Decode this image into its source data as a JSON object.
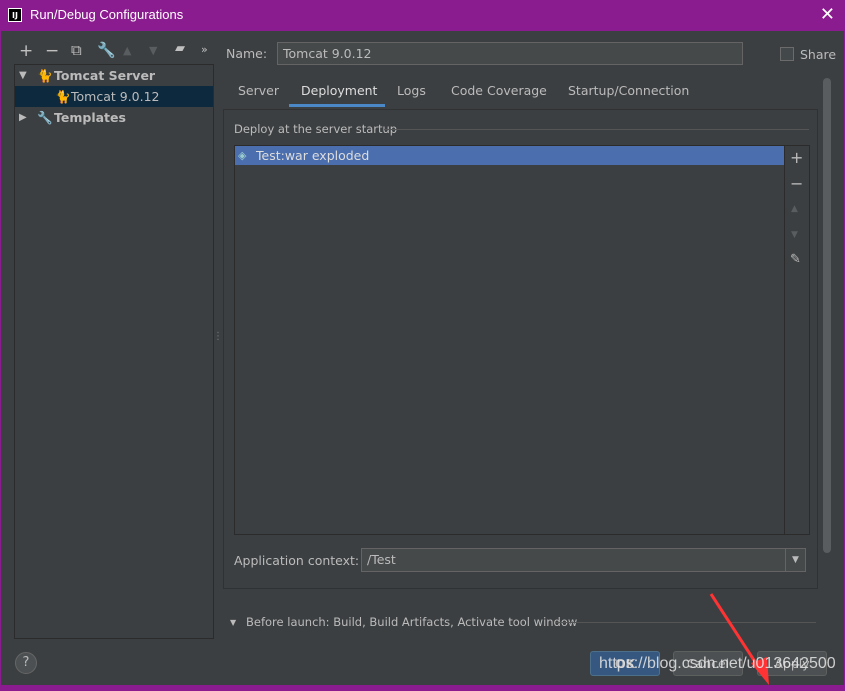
{
  "window": {
    "title": "Run/Debug Configurations",
    "app_icon": "IJ"
  },
  "toolbar": {
    "icons": [
      "plus-icon",
      "minus-icon",
      "copy-icon",
      "wrench-icon",
      "arrow-up-icon",
      "arrow-down-icon",
      "folder-add-icon",
      "more-icon"
    ]
  },
  "tree": {
    "items": [
      {
        "label": "Tomcat Server",
        "expanded": true
      },
      {
        "label": "Tomcat 9.0.12",
        "selected": true
      },
      {
        "label": "Templates",
        "expanded": false
      }
    ]
  },
  "name": {
    "label": "Name:",
    "value": "Tomcat 9.0.12"
  },
  "share": {
    "label": "Share",
    "checked": false
  },
  "tabs": [
    {
      "label": "Server"
    },
    {
      "label": "Deployment",
      "active": true
    },
    {
      "label": "Logs"
    },
    {
      "label": "Code Coverage"
    },
    {
      "label": "Startup/Connection"
    }
  ],
  "deployment": {
    "section_label": "Deploy at the server startup",
    "items": [
      "Test:war exploded"
    ]
  },
  "app_context": {
    "label": "Application context:",
    "value": "/Test"
  },
  "before_launch": {
    "label": "Before launch: Build, Build Artifacts, Activate tool window"
  },
  "buttons": {
    "ok": "OK",
    "cancel": "Cancel",
    "apply": "Apply",
    "help": "?"
  },
  "watermark": "https://blog.csdn.net/u013642500",
  "colors": {
    "accent": "#4b6eaf",
    "titlebar": "#8b1c8f",
    "selection": "#0d293e",
    "annotation_arrow": "#ff3333"
  }
}
